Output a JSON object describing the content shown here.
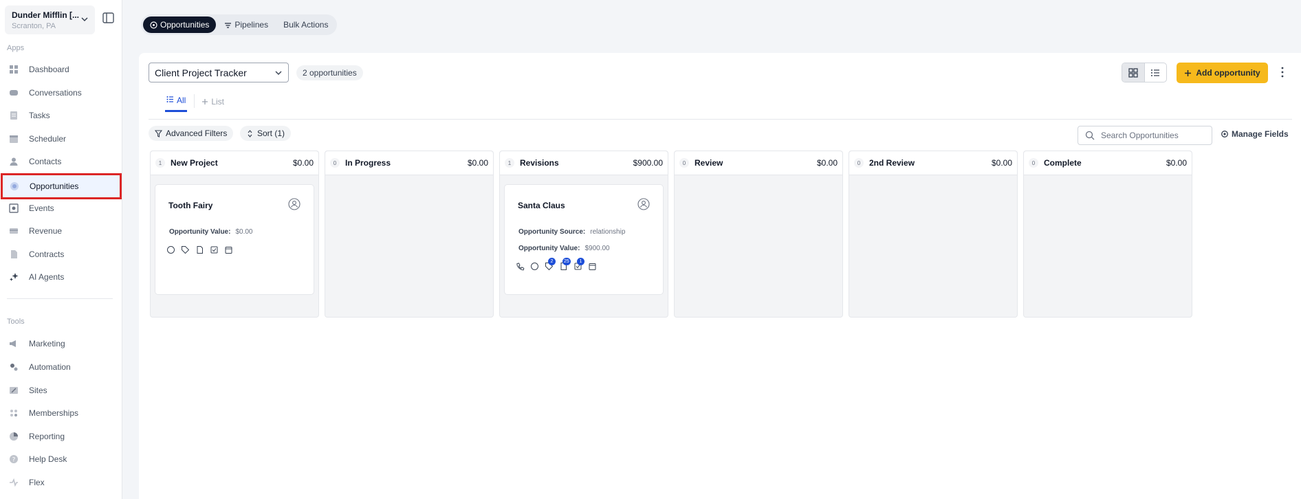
{
  "account": {
    "name": "Dunder Mifflin [...",
    "location": "Scranton, PA"
  },
  "sidebar": {
    "apps_label": "Apps",
    "tools_label": "Tools",
    "apps": [
      {
        "label": "Dashboard",
        "icon": "dashboard-icon"
      },
      {
        "label": "Conversations",
        "icon": "chat-icon"
      },
      {
        "label": "Tasks",
        "icon": "tasks-icon"
      },
      {
        "label": "Scheduler",
        "icon": "calendar-icon"
      },
      {
        "label": "Contacts",
        "icon": "person-icon"
      },
      {
        "label": "Opportunities",
        "icon": "target-icon",
        "active": true
      },
      {
        "label": "Events",
        "icon": "events-icon"
      },
      {
        "label": "Revenue",
        "icon": "card-icon"
      },
      {
        "label": "Contracts",
        "icon": "document-icon"
      },
      {
        "label": "AI Agents",
        "icon": "sparkle-icon"
      }
    ],
    "tools": [
      {
        "label": "Marketing",
        "icon": "megaphone-icon"
      },
      {
        "label": "Automation",
        "icon": "gears-icon"
      },
      {
        "label": "Sites",
        "icon": "sites-icon"
      },
      {
        "label": "Memberships",
        "icon": "members-icon"
      },
      {
        "label": "Reporting",
        "icon": "pie-icon"
      },
      {
        "label": "Help Desk",
        "icon": "help-icon"
      },
      {
        "label": "Flex",
        "icon": "flex-icon"
      }
    ]
  },
  "top_tabs": [
    {
      "label": "Opportunities",
      "active": true
    },
    {
      "label": "Pipelines"
    },
    {
      "label": "Bulk Actions"
    }
  ],
  "toolbar": {
    "pipeline": "Client Project Tracker",
    "count_label": "2 opportunities",
    "add_label": "Add opportunity"
  },
  "view_tabs": {
    "all": "All",
    "list": "List"
  },
  "filters": {
    "advanced": "Advanced Filters",
    "sort": "Sort (1)",
    "search_placeholder": "Search Opportunities",
    "manage": "Manage Fields"
  },
  "columns": [
    {
      "count": "1",
      "name": "New Project",
      "total": "$0.00"
    },
    {
      "count": "0",
      "name": "In Progress",
      "total": "$0.00"
    },
    {
      "count": "1",
      "name": "Revisions",
      "total": "$900.00"
    },
    {
      "count": "0",
      "name": "Review",
      "total": "$0.00"
    },
    {
      "count": "0",
      "name": "2nd Review",
      "total": "$0.00"
    },
    {
      "count": "0",
      "name": "Complete",
      "total": "$0.00"
    }
  ],
  "cards": {
    "tooth_fairy": {
      "title": "Tooth Fairy",
      "value_label": "Opportunity Value:",
      "value": "$0.00"
    },
    "santa_claus": {
      "title": "Santa Claus",
      "source_label": "Opportunity Source:",
      "source": "relationship",
      "value_label": "Opportunity Value:",
      "value": "$900.00",
      "badges": {
        "tags": "2",
        "notes": "25",
        "tasks": "1"
      }
    }
  },
  "colors": {
    "accent_blue": "#1d4ed8",
    "add_button": "#f6b91c",
    "active_highlight": "#dc2626"
  }
}
